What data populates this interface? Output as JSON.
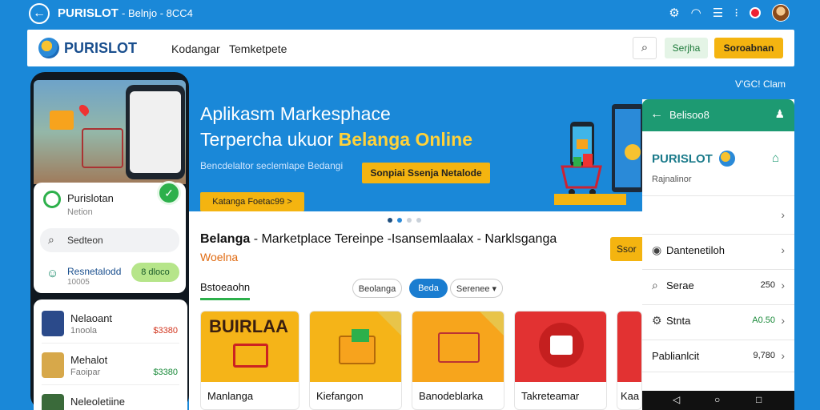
{
  "system_bar": {
    "title": "PURISLOT",
    "subtitle": "- Belnjo - 8CC4",
    "icons": [
      "settings-icon",
      "wifi-icon",
      "menu-icon",
      "more-icon",
      "notification-icon",
      "avatar"
    ]
  },
  "header": {
    "logo": "PURISLOT",
    "nav": [
      "Kodangar",
      "Temketpete"
    ],
    "btn_green": "Serjha",
    "btn_orange": "Soroabnan"
  },
  "hero": {
    "corner_label": "V'GC! Clam",
    "title_line1": "Aplikasm Markesphace",
    "title_line2_plain": "Terpercha ukuor",
    "title_line2_bold": "Belanga Online",
    "subtitle": "Bencdelaltor seclemlape Bedangi",
    "cta": "Sonpiai Ssenja Netalode",
    "badge": "Katanga Foetac99 >"
  },
  "phone": {
    "profile_name": "Purislotan",
    "profile_sub": "Netion",
    "search_placeholder": "Sedteon",
    "user_name": "Resnetalodd",
    "user_sub": "10005",
    "user_pill": "8 dloco",
    "list": [
      {
        "name": "Nelaoant",
        "sub": "1noola",
        "price": "$3380",
        "price_color": "#d2361f"
      },
      {
        "name": "Mehalot",
        "sub": "Faoipar",
        "price": "$3380",
        "price_color": "#1a8a3a"
      },
      {
        "name": "Neleoletiine",
        "sub": "",
        "price": "",
        "price_color": "#222"
      }
    ]
  },
  "main": {
    "title_bold": "Belanga",
    "title_rest": "- Marketplace Tereinpe -Isansemlaalax - Narklsganga",
    "subtitle": "Woelna",
    "side_button": "Ssor",
    "section_label": "Bstoeaohn",
    "chips": [
      "Beolanga",
      "Beda",
      "Serenee ▾"
    ],
    "products": [
      {
        "name": "Manlanga",
        "word": "BUIRLAA"
      },
      {
        "name": "Kiefangon"
      },
      {
        "name": "Banodeblarka"
      },
      {
        "name": "Takreteamar"
      },
      {
        "name": "Kaa"
      }
    ]
  },
  "right_panel": {
    "header_title": "Belisoo8",
    "brand": "PURISLOT",
    "sub": "Rajnalinor",
    "rows": [
      {
        "label": "",
        "value": ""
      },
      {
        "label": "Dantenetiloh",
        "value": ""
      },
      {
        "label": "Serae",
        "value": "250"
      },
      {
        "label": "Stnta",
        "value": "A0.50"
      },
      {
        "label": "Pablianlcit",
        "value": "9,780"
      },
      {
        "label": "",
        "value": ""
      }
    ]
  },
  "colors": {
    "background": "#1a88d8",
    "accent_orange": "#f4b410",
    "accent_green": "#2db04b",
    "panel_teal": "#1d9a72"
  }
}
